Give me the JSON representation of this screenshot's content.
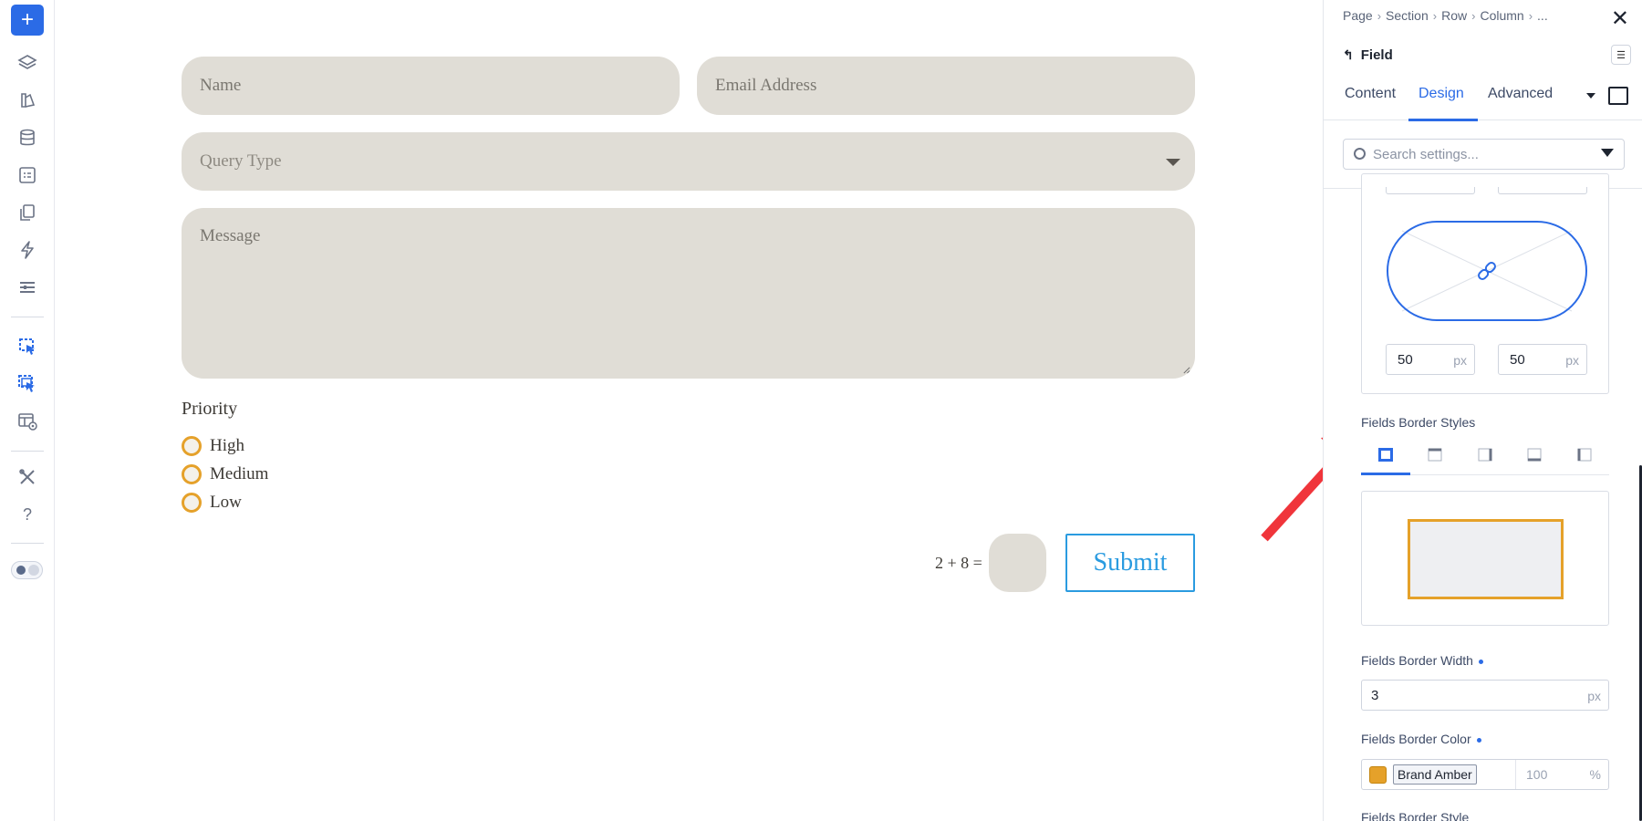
{
  "left_toolbar": {
    "add_label": "+",
    "help_label": "?"
  },
  "form": {
    "name_placeholder": "Name",
    "email_placeholder": "Email Address",
    "query_placeholder": "Query Type",
    "message_placeholder": "Message",
    "priority_title": "Priority",
    "priority_options": [
      "High",
      "Medium",
      "Low"
    ],
    "captcha_question": "2 + 8 =",
    "submit_label": "Submit"
  },
  "panel": {
    "breadcrumb": [
      "Page",
      "Section",
      "Row",
      "Column",
      "..."
    ],
    "title": "Field",
    "tabs": [
      "Content",
      "Design",
      "Advanced"
    ],
    "active_tab": "Design",
    "search_placeholder": "Search settings...",
    "radius_top_left": "50",
    "radius_top_right": "50",
    "radius_unit": "px",
    "border_styles_label": "Fields Border Styles",
    "border_width_label": "Fields Border Width",
    "border_width_value": "3",
    "border_width_unit": "px",
    "border_color_label": "Fields Border Color",
    "border_color_name": "Brand Amber",
    "border_color_opacity": "100",
    "border_color_opacity_unit": "%",
    "border_style_label": "Fields Border Style"
  },
  "colors": {
    "accent": "#2b6be6",
    "field_bg": "#e0ddd6",
    "amber": "#e5a12a",
    "submit_blue": "#2a9be0",
    "annotation_arrow": "#f0353b"
  }
}
